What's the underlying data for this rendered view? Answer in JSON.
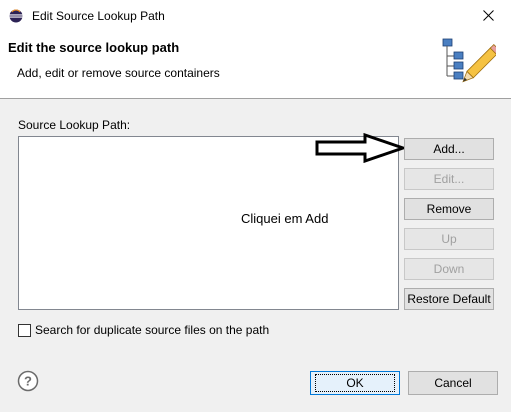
{
  "window": {
    "title": "Edit Source Lookup Path"
  },
  "banner": {
    "title": "Edit the source lookup path",
    "subtitle": "Add, edit or remove source containers"
  },
  "main": {
    "path_label": "Source Lookup Path:",
    "list_items": [],
    "annotation": "Cliquei em Add"
  },
  "buttons": {
    "add": "Add...",
    "edit": "Edit...",
    "remove": "Remove",
    "up": "Up",
    "down": "Down",
    "restore_default": "Restore Default"
  },
  "checkbox": {
    "label": "Search for duplicate source files on the path",
    "checked": false
  },
  "footer": {
    "ok": "OK",
    "cancel": "Cancel"
  },
  "icons": {
    "title": "eclipse-icon",
    "close": "close-icon",
    "banner": "source-lookup-wizard-icon",
    "help": "help-icon",
    "arrow": "arrow-right-icon"
  },
  "colors": {
    "ok_border": "#0078d7",
    "disabled_text": "#a0a0a0"
  }
}
